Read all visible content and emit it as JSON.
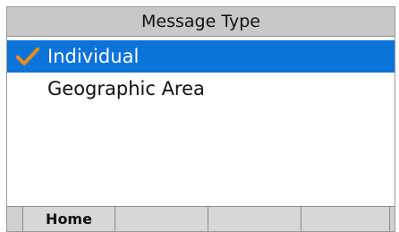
{
  "header": {
    "title": "Message Type"
  },
  "message_types": {
    "selected_index": 0,
    "items": [
      {
        "label": "Individual",
        "icon": "checkmark-icon"
      },
      {
        "label": "Geographic Area"
      }
    ]
  },
  "softkeys": {
    "key1": "Home",
    "key2": "",
    "key3": "",
    "key4": ""
  },
  "colors": {
    "selection": "#0c73d8",
    "checkmark": "#f28c18",
    "title_bar": "#c8c8c8"
  }
}
